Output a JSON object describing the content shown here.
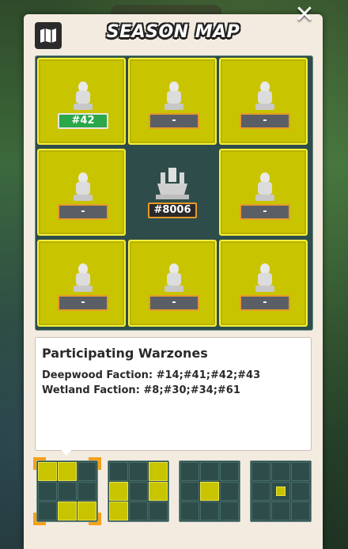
{
  "header": {
    "title": "SEASON MAP"
  },
  "map": {
    "tiles": [
      {
        "label": "#42",
        "highlight": true
      },
      {
        "label": "-"
      },
      {
        "label": "-"
      },
      {
        "label": "-"
      },
      {
        "label": "#8006",
        "center": true
      },
      {
        "label": "-"
      },
      {
        "label": "-"
      },
      {
        "label": "-"
      },
      {
        "label": "-"
      }
    ]
  },
  "info": {
    "title": "Participating Warzones",
    "lines": [
      "Deepwood Faction: #14;#41;#42;#43",
      "Wetland Faction: #8;#30;#34;#61"
    ]
  },
  "selector": {
    "patterns": [
      {
        "selected": true,
        "cells": [
          1,
          1,
          0,
          0,
          0,
          0,
          0,
          1,
          1
        ]
      },
      {
        "selected": false,
        "cells": [
          0,
          0,
          1,
          1,
          0,
          1,
          1,
          0,
          0
        ]
      },
      {
        "selected": false,
        "cells": [
          0,
          0,
          0,
          0,
          1,
          0,
          0,
          0,
          0
        ]
      },
      {
        "selected": false,
        "cells": [
          0,
          0,
          0,
          0,
          1,
          0,
          0,
          0,
          0
        ],
        "small_center": true
      }
    ]
  },
  "colors": {
    "tile": "#c9c400",
    "tile_border": "#f4ef3a",
    "board": "#2e4d4a",
    "panel": "#f4ebe0",
    "accent": "#e79a2a"
  }
}
